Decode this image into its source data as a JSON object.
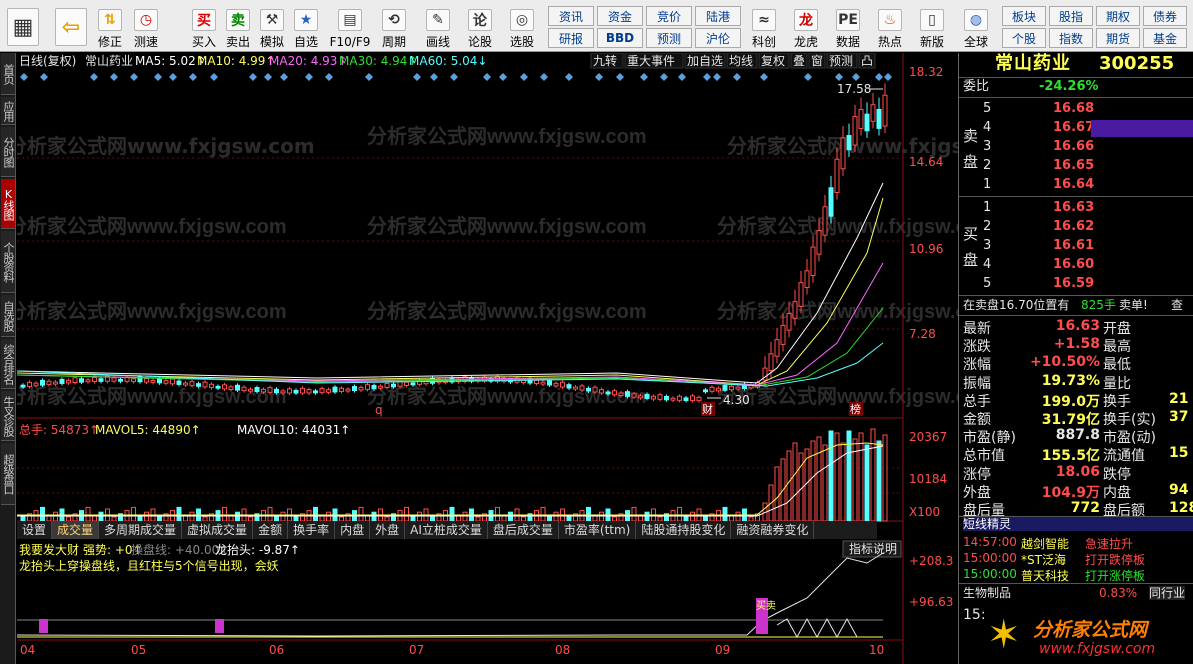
{
  "toolbar": {
    "items": [
      {
        "label": "",
        "icon": "grid-icon"
      },
      {
        "label": "",
        "icon": "back-arrow-icon"
      },
      {
        "label": "修正",
        "icon": "up-down-arrows-icon"
      },
      {
        "label": "测速",
        "icon": "clock-icon"
      },
      {
        "label": "买入",
        "icon": "buy-icon"
      },
      {
        "label": "卖出",
        "icon": "sell-icon"
      },
      {
        "label": "模拟",
        "icon": "hammer-icon"
      },
      {
        "label": "自选",
        "icon": "folder-star-icon"
      },
      {
        "label": "F10/F9",
        "icon": "window-icon"
      },
      {
        "label": "周期",
        "icon": "cycle-icon"
      },
      {
        "label": "画线",
        "icon": "pencil-icon"
      },
      {
        "label": "论股",
        "icon": "discuss-icon"
      },
      {
        "label": "选股",
        "icon": "scan-icon"
      }
    ],
    "small_buttons_top": [
      "资讯",
      "资金",
      "竞价",
      "陆港"
    ],
    "small_buttons_bottom": [
      "研报",
      "BBD",
      "预测",
      "沪伦"
    ],
    "items2": [
      {
        "label": "科创",
        "icon": "chart-icon"
      },
      {
        "label": "龙虎",
        "icon": "dragon-icon"
      },
      {
        "label": "数据",
        "icon": "pe-icon"
      },
      {
        "label": "热点",
        "icon": "fire-icon"
      },
      {
        "label": "新版",
        "icon": "phone-icon"
      },
      {
        "label": "全球",
        "icon": "globe-icon"
      }
    ],
    "right_top": [
      "板块",
      "股指",
      "期权",
      "债券"
    ],
    "right_bottom": [
      "个股",
      "指数",
      "期货",
      "基金"
    ]
  },
  "left_tabs": [
    "首页",
    "应用",
    "分时图",
    "K线图",
    "个股资料",
    "自选股",
    "综合排名",
    "牛叉诊股",
    "超级盘口"
  ],
  "main_header": {
    "period": "日线(复权)",
    "stock": "常山药业",
    "ma": [
      {
        "label": "MA5: 5.02",
        "color": "#ffffff"
      },
      {
        "label": "MA10: 4.99",
        "color": "#ffff55"
      },
      {
        "label": "MA20: 4.93",
        "color": "#ff66ff"
      },
      {
        "label": "MA30: 4.94",
        "color": "#2ee02e"
      },
      {
        "label": "MA60: 5.04",
        "color": "#55ffff"
      }
    ],
    "buttons": [
      "九转",
      "重大事件",
      "加自选",
      "均线",
      "复权",
      "叠",
      "窗",
      "预测",
      "凸"
    ]
  },
  "price_axis": [
    "18.32",
    "14.64",
    "10.96",
    "7.28"
  ],
  "annotations": {
    "high": "17.58",
    "low": "4.30",
    "marker_q": "q",
    "marker_cai": "财",
    "marker_bang": "榜"
  },
  "volume": {
    "header": [
      {
        "label": "总手: 54873",
        "color": "#ff4d4d"
      },
      {
        "label": "MAVOL5: 44890",
        "color": "#ffff55"
      },
      {
        "label": "MAVOL10: 44031",
        "color": "#ffffff"
      }
    ],
    "axis": [
      "20367",
      "10184",
      "X100"
    ]
  },
  "tabs": [
    "设置",
    "成交量",
    "多周期成交量",
    "虚拟成交量",
    "金额",
    "换手率",
    "内盘",
    "外盘",
    "AI立桩成交量",
    "盘后成交量",
    "市盈率(ttm)",
    "陆股通持股变化",
    "融资融券变化"
  ],
  "indicator": {
    "line1": [
      {
        "label": "我要发大财",
        "color": "#ffff55"
      },
      {
        "label": "强势: +0",
        "color": "#ffff55"
      },
      {
        "label": "操盘线: +40.00",
        "color": "#888888"
      },
      {
        "label": "龙抬头: -9.87",
        "color": "#ffffff"
      }
    ],
    "line2": "龙抬头上穿操盘线，且红柱与5个信号出现，会妖",
    "explain_button": "指标说明",
    "axis": [
      "+208.3",
      "+96.63"
    ],
    "marker": "买卖"
  },
  "x_axis": [
    "04",
    "05",
    "06",
    "07",
    "08",
    "09",
    "10"
  ],
  "watermark": "分析家公式网www.fxjgsw.com",
  "side": {
    "title": "常山药业",
    "code": "300255",
    "wei_bi_label": "委比",
    "wei_bi": "-24.26%",
    "sell_label": "卖盘",
    "buy_label": "买盘",
    "sell": [
      {
        "lv": "5",
        "price": "16.68",
        "vol": ""
      },
      {
        "lv": "4",
        "price": "16.67",
        "vol": ""
      },
      {
        "lv": "3",
        "price": "16.66",
        "vol": ""
      },
      {
        "lv": "2",
        "price": "16.65",
        "vol": ""
      },
      {
        "lv": "1",
        "price": "16.64",
        "vol": ""
      }
    ],
    "buy": [
      {
        "lv": "1",
        "price": "16.63"
      },
      {
        "lv": "2",
        "price": "16.62"
      },
      {
        "lv": "3",
        "price": "16.61"
      },
      {
        "lv": "4",
        "price": "16.60"
      },
      {
        "lv": "5",
        "price": "16.59"
      }
    ],
    "note": "在卖盘16.70位置有",
    "note_vol": "825手",
    "note_tail": "卖单!",
    "note_more": "查",
    "stats": [
      {
        "k": "最新",
        "v": "16.63",
        "c": "#ff4d4d",
        "k2": "开盘",
        "v2": ""
      },
      {
        "k": "涨跌",
        "v": "+1.58",
        "c": "#ff4d4d",
        "k2": "最高",
        "v2": ""
      },
      {
        "k": "涨幅",
        "v": "+10.50%",
        "c": "#ff4d4d",
        "k2": "最低",
        "v2": ""
      },
      {
        "k": "振幅",
        "v": "19.73%",
        "c": "#ffff55",
        "k2": "量比",
        "v2": ""
      },
      {
        "k": "总手",
        "v": "199.0万",
        "c": "#ffff55",
        "k2": "换手",
        "v2": "21"
      },
      {
        "k": "金额",
        "v": "31.79亿",
        "c": "#ffff55",
        "k2": "换手(实)",
        "v2": "37"
      },
      {
        "k": "市盈(静)",
        "v": "887.8",
        "c": "#e6e6e6",
        "k2": "市盈(动)",
        "v2": ""
      },
      {
        "k": "总市值",
        "v": "155.5亿",
        "c": "#ffff55",
        "k2": "流通值",
        "v2": "15"
      },
      {
        "k": "涨停",
        "v": "18.06",
        "c": "#ff4d4d",
        "k2": "跌停",
        "v2": ""
      },
      {
        "k": "外盘",
        "v": "104.9万",
        "c": "#ff4d4d",
        "k2": "内盘",
        "v2": "94"
      },
      {
        "k": "盘后量",
        "v": "772",
        "c": "#ffff55",
        "k2": "盘后额",
        "v2": "128"
      }
    ],
    "short_title": "短线精灵",
    "short": [
      {
        "t": "14:57:00",
        "n": "越剑智能",
        "e": "急速拉升"
      },
      {
        "t": "15:00:00",
        "n": "*ST泛海",
        "e": "打开跌停板"
      },
      {
        "t": "15:00:00",
        "n": "普天科技",
        "e": "打开涨停板"
      }
    ],
    "sector": "生物制品",
    "sector_pct": "0.83%",
    "sector_tail": "同行业",
    "bottom_time": "15:",
    "logo_text": "分析家公式网",
    "logo_url": "www.fxjgsw.com"
  }
}
